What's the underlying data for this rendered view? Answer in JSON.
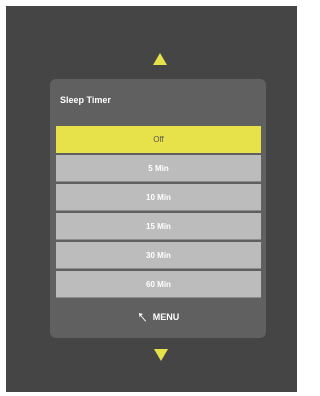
{
  "menu": {
    "title": "Sleep Timer",
    "options": [
      "Off",
      "5 Min",
      "10 Min",
      "15 Min",
      "30 Min",
      "60 Min"
    ],
    "selected_index": 0,
    "footer_label": "MENU"
  },
  "icons": {
    "up": "up-arrow-icon",
    "down": "down-arrow-icon",
    "back": "back-arrow-icon"
  },
  "colors": {
    "highlight": "#e8e24a",
    "panel": "#606060",
    "option": "#bcbcbc",
    "background": "#454545"
  }
}
